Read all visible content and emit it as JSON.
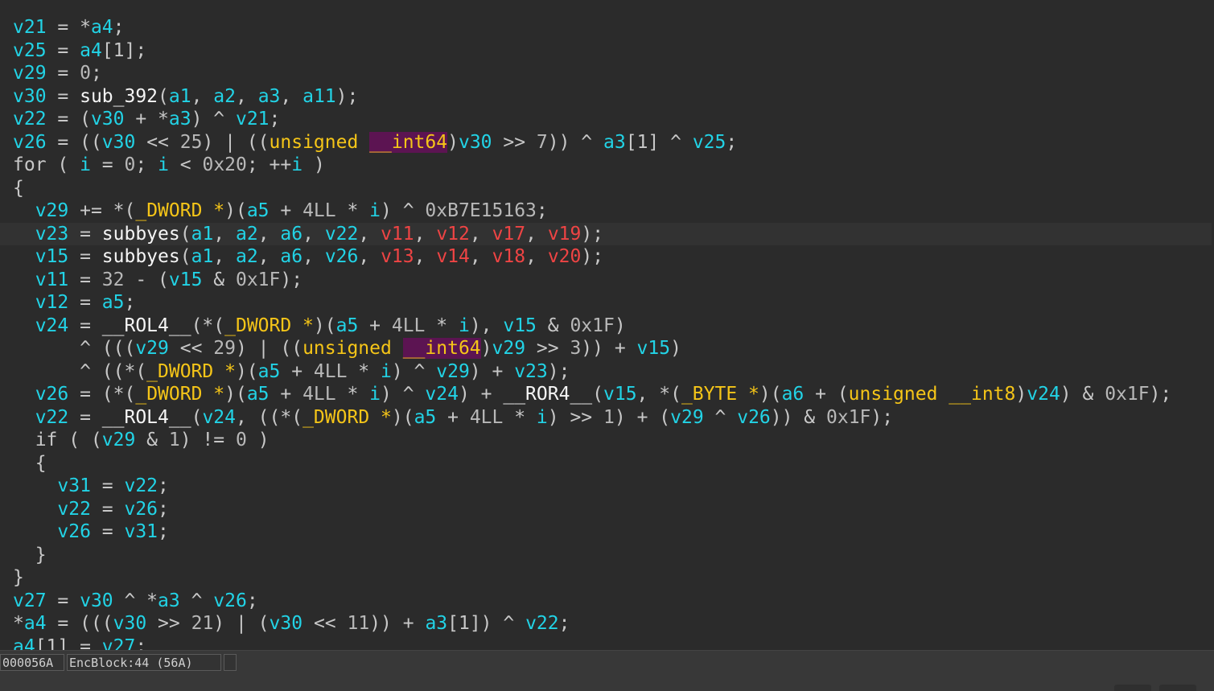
{
  "colors": {
    "background": "#2b2b2b",
    "variable": "#22d3e6",
    "register_arg": "#ef4444",
    "keyword_type": "#f5c518",
    "function": "#f5f5f5",
    "number": "#b8b8b8",
    "operator": "#c8c8c8",
    "highlight_mark": "#5c1452",
    "current_line": "#323232"
  },
  "code": {
    "highlighted_line_index": 9,
    "lines": [
      [
        [
          "var",
          "v21"
        ],
        [
          "op",
          " = *"
        ],
        [
          "var",
          "a4"
        ],
        [
          "op",
          ";"
        ]
      ],
      [
        [
          "var",
          "v25"
        ],
        [
          "op",
          " = "
        ],
        [
          "var",
          "a4"
        ],
        [
          "op",
          "[1];"
        ]
      ],
      [
        [
          "var",
          "v29"
        ],
        [
          "op",
          " = "
        ],
        [
          "num",
          "0"
        ],
        [
          "op",
          ";"
        ]
      ],
      [
        [
          "var",
          "v30"
        ],
        [
          "op",
          " = "
        ],
        [
          "fn",
          "sub_392"
        ],
        [
          "op",
          "("
        ],
        [
          "var",
          "a1"
        ],
        [
          "op",
          ", "
        ],
        [
          "var",
          "a2"
        ],
        [
          "op",
          ", "
        ],
        [
          "var",
          "a3"
        ],
        [
          "op",
          ", "
        ],
        [
          "var",
          "a11"
        ],
        [
          "op",
          ");"
        ]
      ],
      [
        [
          "var",
          "v22"
        ],
        [
          "op",
          " = ("
        ],
        [
          "var",
          "v30"
        ],
        [
          "op",
          " + *"
        ],
        [
          "var",
          "a3"
        ],
        [
          "op",
          ") ^ "
        ],
        [
          "var",
          "v21"
        ],
        [
          "op",
          ";"
        ]
      ],
      [
        [
          "var",
          "v26"
        ],
        [
          "op",
          " = (("
        ],
        [
          "var",
          "v30"
        ],
        [
          "op",
          " << "
        ],
        [
          "num",
          "25"
        ],
        [
          "op",
          ") | (("
        ],
        [
          "kw",
          "unsigned"
        ],
        [
          "op",
          " "
        ],
        [
          "mark",
          "__int64"
        ],
        [
          "op",
          ")"
        ],
        [
          "var",
          "v30"
        ],
        [
          "op",
          " >> "
        ],
        [
          "num",
          "7"
        ],
        [
          "op",
          ")) ^ "
        ],
        [
          "var",
          "a3"
        ],
        [
          "op",
          "[1] ^ "
        ],
        [
          "var",
          "v25"
        ],
        [
          "op",
          ";"
        ]
      ],
      [
        [
          "op",
          "for ( "
        ],
        [
          "var",
          "i"
        ],
        [
          "op",
          " = "
        ],
        [
          "num",
          "0"
        ],
        [
          "op",
          "; "
        ],
        [
          "var",
          "i"
        ],
        [
          "op",
          " < "
        ],
        [
          "num",
          "0x20"
        ],
        [
          "op",
          "; ++"
        ],
        [
          "var",
          "i"
        ],
        [
          "op",
          " )"
        ]
      ],
      [
        [
          "op",
          "{"
        ]
      ],
      [
        [
          "op",
          "  "
        ],
        [
          "var",
          "v29"
        ],
        [
          "op",
          " += *("
        ],
        [
          "kw",
          "_DWORD *"
        ],
        [
          "op",
          ")("
        ],
        [
          "var",
          "a5"
        ],
        [
          "op",
          " + "
        ],
        [
          "num",
          "4LL"
        ],
        [
          "op",
          " * "
        ],
        [
          "var",
          "i"
        ],
        [
          "op",
          ") ^ "
        ],
        [
          "num",
          "0xB7E15163"
        ],
        [
          "op",
          ";"
        ]
      ],
      [
        [
          "op",
          "  "
        ],
        [
          "var",
          "v23"
        ],
        [
          "op",
          " = "
        ],
        [
          "fn",
          "subbyes"
        ],
        [
          "op",
          "("
        ],
        [
          "var",
          "a1"
        ],
        [
          "op",
          ", "
        ],
        [
          "var",
          "a2"
        ],
        [
          "op",
          ", "
        ],
        [
          "var",
          "a6"
        ],
        [
          "op",
          ", "
        ],
        [
          "var",
          "v22"
        ],
        [
          "op",
          ", "
        ],
        [
          "red",
          "v11"
        ],
        [
          "op",
          ", "
        ],
        [
          "red",
          "v12"
        ],
        [
          "op",
          ", "
        ],
        [
          "red",
          "v17"
        ],
        [
          "op",
          ", "
        ],
        [
          "red",
          "v19"
        ],
        [
          "op",
          ");"
        ]
      ],
      [
        [
          "op",
          "  "
        ],
        [
          "var",
          "v15"
        ],
        [
          "op",
          " = "
        ],
        [
          "fn",
          "subbyes"
        ],
        [
          "op",
          "("
        ],
        [
          "var",
          "a1"
        ],
        [
          "op",
          ", "
        ],
        [
          "var",
          "a2"
        ],
        [
          "op",
          ", "
        ],
        [
          "var",
          "a6"
        ],
        [
          "op",
          ", "
        ],
        [
          "var",
          "v26"
        ],
        [
          "op",
          ", "
        ],
        [
          "red",
          "v13"
        ],
        [
          "op",
          ", "
        ],
        [
          "red",
          "v14"
        ],
        [
          "op",
          ", "
        ],
        [
          "red",
          "v18"
        ],
        [
          "op",
          ", "
        ],
        [
          "red",
          "v20"
        ],
        [
          "op",
          ");"
        ]
      ],
      [
        [
          "op",
          "  "
        ],
        [
          "var",
          "v11"
        ],
        [
          "op",
          " = "
        ],
        [
          "num",
          "32"
        ],
        [
          "op",
          " - ("
        ],
        [
          "var",
          "v15"
        ],
        [
          "op",
          " & "
        ],
        [
          "num",
          "0x1F"
        ],
        [
          "op",
          ");"
        ]
      ],
      [
        [
          "op",
          "  "
        ],
        [
          "var",
          "v12"
        ],
        [
          "op",
          " = "
        ],
        [
          "var",
          "a5"
        ],
        [
          "op",
          ";"
        ]
      ],
      [
        [
          "op",
          "  "
        ],
        [
          "var",
          "v24"
        ],
        [
          "op",
          " = "
        ],
        [
          "fn",
          "__ROL4__"
        ],
        [
          "op",
          "(*("
        ],
        [
          "kw",
          "_DWORD *"
        ],
        [
          "op",
          ")("
        ],
        [
          "var",
          "a5"
        ],
        [
          "op",
          " + "
        ],
        [
          "num",
          "4LL"
        ],
        [
          "op",
          " * "
        ],
        [
          "var",
          "i"
        ],
        [
          "op",
          "), "
        ],
        [
          "var",
          "v15"
        ],
        [
          "op",
          " & "
        ],
        [
          "num",
          "0x1F"
        ],
        [
          "op",
          ")"
        ]
      ],
      [
        [
          "op",
          "      ^ ((("
        ],
        [
          "var",
          "v29"
        ],
        [
          "op",
          " << "
        ],
        [
          "num",
          "29"
        ],
        [
          "op",
          ") | (("
        ],
        [
          "kw",
          "unsigned"
        ],
        [
          "op",
          " "
        ],
        [
          "mark",
          "__int64"
        ],
        [
          "op",
          ")"
        ],
        [
          "var",
          "v29"
        ],
        [
          "op",
          " >> "
        ],
        [
          "num",
          "3"
        ],
        [
          "op",
          ")) + "
        ],
        [
          "var",
          "v15"
        ],
        [
          "op",
          ")"
        ]
      ],
      [
        [
          "op",
          "      ^ ((*("
        ],
        [
          "kw",
          "_DWORD *"
        ],
        [
          "op",
          ")("
        ],
        [
          "var",
          "a5"
        ],
        [
          "op",
          " + "
        ],
        [
          "num",
          "4LL"
        ],
        [
          "op",
          " * "
        ],
        [
          "var",
          "i"
        ],
        [
          "op",
          ") ^ "
        ],
        [
          "var",
          "v29"
        ],
        [
          "op",
          ") + "
        ],
        [
          "var",
          "v23"
        ],
        [
          "op",
          ");"
        ]
      ],
      [
        [
          "op",
          "  "
        ],
        [
          "var",
          "v26"
        ],
        [
          "op",
          " = (*("
        ],
        [
          "kw",
          "_DWORD *"
        ],
        [
          "op",
          ")("
        ],
        [
          "var",
          "a5"
        ],
        [
          "op",
          " + "
        ],
        [
          "num",
          "4LL"
        ],
        [
          "op",
          " * "
        ],
        [
          "var",
          "i"
        ],
        [
          "op",
          ") ^ "
        ],
        [
          "var",
          "v24"
        ],
        [
          "op",
          ") + "
        ],
        [
          "fn",
          "__ROR4__"
        ],
        [
          "op",
          "("
        ],
        [
          "var",
          "v15"
        ],
        [
          "op",
          ", *("
        ],
        [
          "kw",
          "_BYTE *"
        ],
        [
          "op",
          ")("
        ],
        [
          "var",
          "a6"
        ],
        [
          "op",
          " + ("
        ],
        [
          "kw",
          "unsigned __int8"
        ],
        [
          "op",
          ")"
        ],
        [
          "var",
          "v24"
        ],
        [
          "op",
          ") & "
        ],
        [
          "num",
          "0x1F"
        ],
        [
          "op",
          ");"
        ]
      ],
      [
        [
          "op",
          "  "
        ],
        [
          "var",
          "v22"
        ],
        [
          "op",
          " = "
        ],
        [
          "fn",
          "__ROL4__"
        ],
        [
          "op",
          "("
        ],
        [
          "var",
          "v24"
        ],
        [
          "op",
          ", ((*("
        ],
        [
          "kw",
          "_DWORD *"
        ],
        [
          "op",
          ")("
        ],
        [
          "var",
          "a5"
        ],
        [
          "op",
          " + "
        ],
        [
          "num",
          "4LL"
        ],
        [
          "op",
          " * "
        ],
        [
          "var",
          "i"
        ],
        [
          "op",
          ") >> "
        ],
        [
          "num",
          "1"
        ],
        [
          "op",
          ") + ("
        ],
        [
          "var",
          "v29"
        ],
        [
          "op",
          " ^ "
        ],
        [
          "var",
          "v26"
        ],
        [
          "op",
          ")) & "
        ],
        [
          "num",
          "0x1F"
        ],
        [
          "op",
          ");"
        ]
      ],
      [
        [
          "op",
          "  if ( ("
        ],
        [
          "var",
          "v29"
        ],
        [
          "op",
          " & "
        ],
        [
          "num",
          "1"
        ],
        [
          "op",
          ") != "
        ],
        [
          "num",
          "0"
        ],
        [
          "op",
          " )"
        ]
      ],
      [
        [
          "op",
          "  {"
        ]
      ],
      [
        [
          "op",
          "    "
        ],
        [
          "var",
          "v31"
        ],
        [
          "op",
          " = "
        ],
        [
          "var",
          "v22"
        ],
        [
          "op",
          ";"
        ]
      ],
      [
        [
          "op",
          "    "
        ],
        [
          "var",
          "v22"
        ],
        [
          "op",
          " = "
        ],
        [
          "var",
          "v26"
        ],
        [
          "op",
          ";"
        ]
      ],
      [
        [
          "op",
          "    "
        ],
        [
          "var",
          "v26"
        ],
        [
          "op",
          " = "
        ],
        [
          "var",
          "v31"
        ],
        [
          "op",
          ";"
        ]
      ],
      [
        [
          "op",
          "  }"
        ]
      ],
      [
        [
          "op",
          "}"
        ]
      ],
      [
        [
          "var",
          "v27"
        ],
        [
          "op",
          " = "
        ],
        [
          "var",
          "v30"
        ],
        [
          "op",
          " ^ *"
        ],
        [
          "var",
          "a3"
        ],
        [
          "op",
          " ^ "
        ],
        [
          "var",
          "v26"
        ],
        [
          "op",
          ";"
        ]
      ],
      [
        [
          "op",
          "*"
        ],
        [
          "var",
          "a4"
        ],
        [
          "op",
          " = ((("
        ],
        [
          "var",
          "v30"
        ],
        [
          "op",
          " >> "
        ],
        [
          "num",
          "21"
        ],
        [
          "op",
          ") | ("
        ],
        [
          "var",
          "v30"
        ],
        [
          "op",
          " << "
        ],
        [
          "num",
          "11"
        ],
        [
          "op",
          ")) + "
        ],
        [
          "var",
          "a3"
        ],
        [
          "op",
          "[1]) ^ "
        ],
        [
          "var",
          "v22"
        ],
        [
          "op",
          ";"
        ]
      ],
      [
        [
          "var",
          "a4"
        ],
        [
          "op",
          "[1] = "
        ],
        [
          "var",
          "v27"
        ],
        [
          "op",
          ";"
        ]
      ]
    ]
  },
  "statusbar": {
    "address": "000056A",
    "function_location": "EncBlock:44 (56A)",
    "extra": ""
  }
}
